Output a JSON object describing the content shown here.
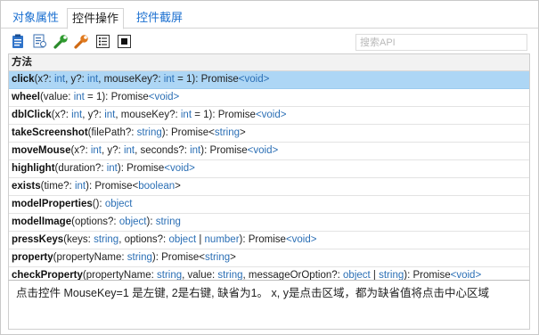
{
  "tabs": [
    {
      "label": "对象属性",
      "active": false
    },
    {
      "label": "控件操作",
      "active": true
    },
    {
      "label": "控件截屏",
      "active": false
    }
  ],
  "toolbar": {
    "icons": [
      "clipboard-icon",
      "document-list-icon",
      "green-wrench-icon",
      "orange-wrench-icon",
      "list-view-icon",
      "window-icon"
    ],
    "search_placeholder": "搜索API"
  },
  "grid": {
    "header": "方法",
    "selected_index": 0,
    "rows": [
      {
        "name": "click",
        "sig": "(x?: int, y?: int, mouseKey?: int = 1): Promise<void>"
      },
      {
        "name": "wheel",
        "sig": "(value: int = 1): Promise<void>"
      },
      {
        "name": "dblClick",
        "sig": "(x?: int, y?: int, mouseKey?: int = 1): Promise<void>"
      },
      {
        "name": "takeScreenshot",
        "sig": "(filePath?: string): Promise<string>"
      },
      {
        "name": "moveMouse",
        "sig": "(x?: int, y?: int, seconds?: int): Promise<void>"
      },
      {
        "name": "highlight",
        "sig": "(duration?: int): Promise<void>"
      },
      {
        "name": "exists",
        "sig": "(time?: int): Promise<boolean>"
      },
      {
        "name": "modelProperties",
        "sig": "(): object"
      },
      {
        "name": "modelImage",
        "sig": "(options?: object): string"
      },
      {
        "name": "pressKeys",
        "sig": "(keys: string, options?: object | number): Promise<void>"
      },
      {
        "name": "property",
        "sig": "(propertyName: string): Promise<string>"
      },
      {
        "name": "checkProperty",
        "sig": "(propertyName: string, value: string, messageOrOption?: object | string): Promise<void>"
      }
    ]
  },
  "description": "点击控件 MouseKey=1 是左键, 2是右键, 缺省为1。 x, y是点击区域，都为缺省值将点击中心区域",
  "colors": {
    "tab_link": "#1a6fd0",
    "selected_row": "#add6f5",
    "type_text": "#2b6fb5"
  }
}
